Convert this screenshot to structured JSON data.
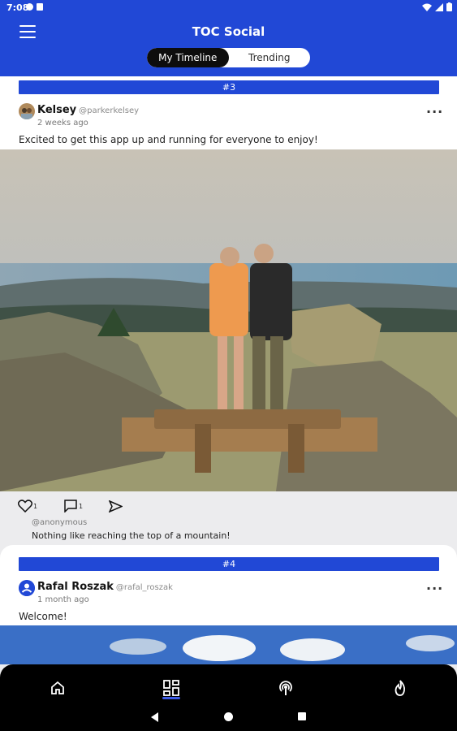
{
  "status": {
    "time": "7:08"
  },
  "app": {
    "title": "TOC Social"
  },
  "tabs": {
    "active": "My Timeline",
    "inactive": "Trending"
  },
  "posts": [
    {
      "number": "#3",
      "author": "Kelsey",
      "handle": "@parkerkelsey",
      "time_ago": "2 weeks ago",
      "text": "Excited to get this app up and running for everyone to enjoy!",
      "likes": "1",
      "comments": "1",
      "comment": {
        "user": "@anonymous",
        "text": "Nothing like reaching the top of a mountain!"
      }
    },
    {
      "number": "#4",
      "author": "Rafal Roszak",
      "handle": "@rafal_roszak",
      "time_ago": "1 month ago",
      "text": "Welcome!"
    }
  ],
  "bottom_nav": [
    "home-icon",
    "dashboard-icon",
    "podcast-icon",
    "fire-icon"
  ],
  "colors": {
    "brand": "#2148d6",
    "background": "#ececee",
    "nav": "#000000"
  }
}
